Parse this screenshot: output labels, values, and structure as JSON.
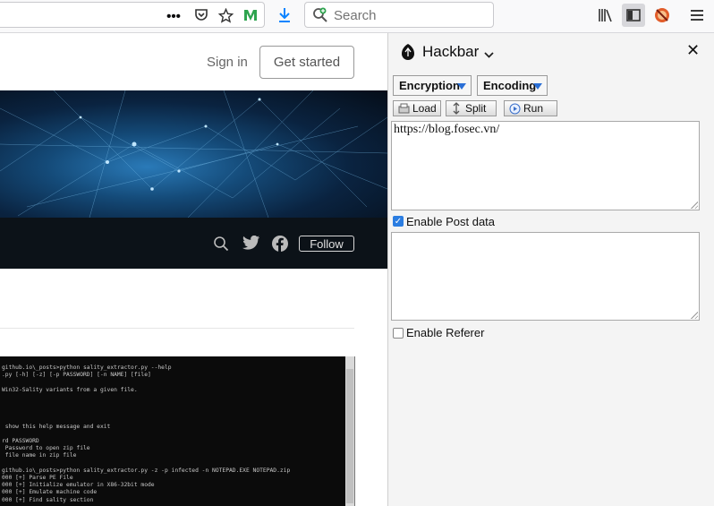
{
  "browser": {
    "search_placeholder": "Search",
    "icons": [
      "more-icon",
      "pocket-icon",
      "bookmark-star-icon",
      "medium-extension-icon",
      "download-icon",
      "library-icon",
      "sidebar-icon",
      "extension-icon",
      "menu-icon"
    ]
  },
  "page": {
    "signin": "Sign in",
    "get_started": "Get started",
    "follow": "Follow",
    "terminal_lines": [
      "github.io\\_posts>python sality_extractor.py --help",
      ".py [-h] [-z] [-p PASSWORD] [-n NAME] [file]",
      "",
      "Win32-Sality variants from a given file.",
      "",
      "",
      "",
      "",
      " show this help message and exit",
      "",
      "rd PASSWORD",
      " Password to open zip file",
      " file name in zip file",
      "",
      "github.io\\_posts>python sality_extractor.py -z -p infected -n NOTEPAD.EXE NOTEPAD.zip",
      "000 [+] Parse PE File",
      "000 [+] Initialize emulator in X86-32bit mode",
      "000 [+] Emulate machine code",
      "000 [+] Find sality section"
    ]
  },
  "hackbar": {
    "title": "Hackbar",
    "close": "✕",
    "encryption": "Encryption",
    "encoding": "Encoding",
    "load": "Load",
    "split": "Split",
    "run": "Run",
    "url": "https://blog.fosec.vn/",
    "enable_post": "Enable Post data",
    "enable_post_checked": true,
    "enable_referer": "Enable Referer",
    "enable_referer_checked": false
  },
  "colors": {
    "accent": "#2b7de1",
    "banner_dark": "#050d18",
    "navbar": "#0c1218"
  }
}
